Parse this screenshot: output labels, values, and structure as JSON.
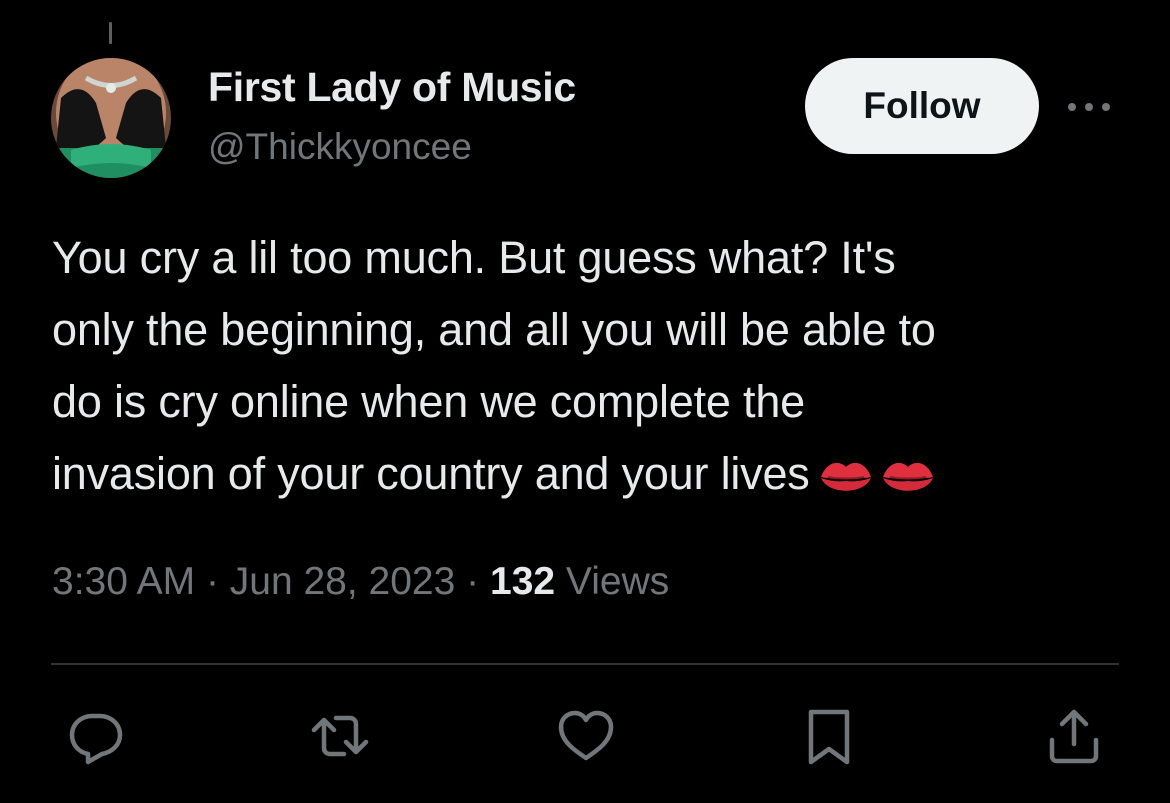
{
  "author": {
    "display_name": "First Lady of Music",
    "handle": "@Thickkyoncee"
  },
  "follow_label": "Follow",
  "tweet": {
    "lines": [
      "You cry a lil too much. But guess what? It's",
      "only the beginning, and all you will be able to",
      "do is cry online when we complete the",
      "invasion of your country and your lives"
    ],
    "emoji": [
      "kiss-mark",
      "kiss-mark"
    ]
  },
  "meta": {
    "time": "3:30 AM",
    "separator": "·",
    "date": "Jun 28, 2023",
    "views_count": "132",
    "views_label": "Views"
  },
  "actions": [
    "reply-icon",
    "retweet-icon",
    "like-icon",
    "bookmark-icon",
    "share-icon"
  ],
  "colors": {
    "background": "#000000",
    "text_primary": "#e7e9ea",
    "text_secondary": "#71767b",
    "follow_bg": "#eff3f4",
    "divider": "#2f3336",
    "emoji_red": "#e0303f"
  }
}
